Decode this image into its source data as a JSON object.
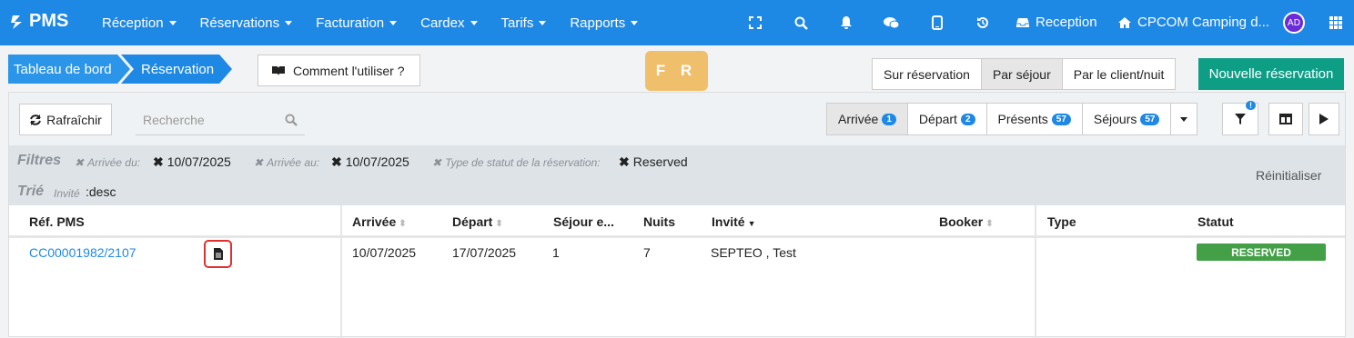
{
  "header": {
    "logo": "PMS",
    "menu": [
      "Réception",
      "Réservations",
      "Facturation",
      "Cardex",
      "Tarifs",
      "Rapports"
    ],
    "reception_label": "Reception",
    "site_label": "CPCOM Camping d...",
    "avatar_initials": "AD"
  },
  "breadcrumb": {
    "home": "Tableau de bord",
    "current": "Réservation"
  },
  "help_label": "Comment l'utiliser ?",
  "language": "F R",
  "view_modes": [
    "Sur réservation",
    "Par séjour",
    "Par le client/nuit"
  ],
  "new_reservation_label": "Nouvelle réservation",
  "toolbar": {
    "refresh_label": "Rafraîchir",
    "search_placeholder": "Recherche",
    "tabs": [
      {
        "label": "Arrivée",
        "count": "1"
      },
      {
        "label": "Départ",
        "count": "2"
      },
      {
        "label": "Présents",
        "count": "57"
      },
      {
        "label": "Séjours",
        "count": "57"
      }
    ],
    "filter_badge": "!"
  },
  "filters": {
    "title": "Filtres",
    "items": [
      {
        "label": "Arrivée du:",
        "value": "10/07/2025"
      },
      {
        "label": "Arrivée au:",
        "value": "10/07/2025"
      },
      {
        "label": "Type de statut de la réservation:",
        "value": "Reserved"
      }
    ],
    "sort_title": "Trié",
    "sort_field": "Invité",
    "sort_value": ":desc",
    "reset_label": "Réinitialiser"
  },
  "table": {
    "columns": [
      "Réf. PMS",
      "Arrivée",
      "Départ",
      "Séjour e...",
      "Nuits",
      "Invité",
      "Booker",
      "Type",
      "Statut"
    ],
    "rows": [
      {
        "ref": "CC00001982/2107",
        "arrival": "10/07/2025",
        "departure": "17/07/2025",
        "stay": "1",
        "nights": "7",
        "guest": "SEPTEO , Test",
        "booker": "",
        "type": "",
        "status": "RESERVED"
      }
    ]
  },
  "colors": {
    "primary": "#1e88e5",
    "success": "#43a047",
    "accent": "#0e9e86",
    "lang": "#f0bf6c"
  }
}
